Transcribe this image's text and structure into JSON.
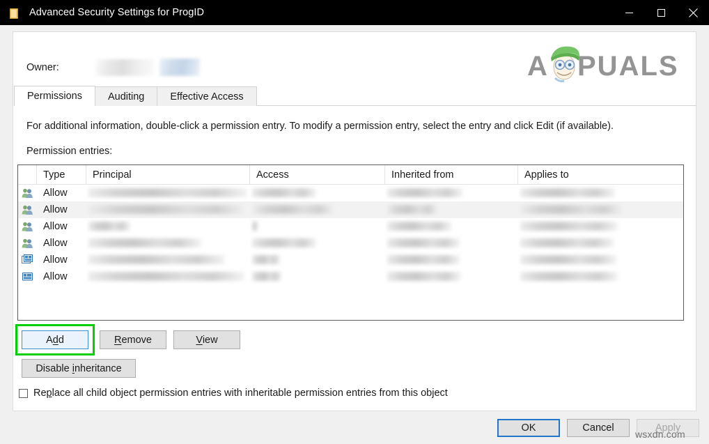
{
  "window": {
    "title": "Advanced Security Settings for ProgID",
    "icon": "folder-icon",
    "caption_buttons": [
      {
        "name": "minimize",
        "glyph": "minimize-icon"
      },
      {
        "name": "maximize",
        "glyph": "maximize-icon"
      },
      {
        "name": "close",
        "glyph": "close-icon"
      }
    ]
  },
  "branding": {
    "logo_text": "APPUALS",
    "logo_color": "#8c8c8c",
    "hat_color": "#6abf5a",
    "watermark": "wsxdn.com",
    "watermark_color": "#767676"
  },
  "owner": {
    "label": "Owner:",
    "value": "",
    "change_link": ""
  },
  "tabs": [
    {
      "label": "Permissions",
      "active": true
    },
    {
      "label": "Auditing",
      "active": false
    },
    {
      "label": "Effective Access",
      "active": false
    }
  ],
  "description": "For additional information, double-click a permission entry. To modify a permission entry, select the entry and click Edit (if available).",
  "entries_label": "Permission entries:",
  "table": {
    "columns": [
      "",
      "Type",
      "Principal",
      "Access",
      "Inherited from",
      "Applies to"
    ],
    "rows": [
      {
        "icon": "users-group-icon",
        "type": "Allow",
        "principal": "",
        "access": "",
        "inherited_from": "",
        "applies_to": "",
        "selected": false
      },
      {
        "icon": "users-group-icon",
        "type": "Allow",
        "principal": "",
        "access": "",
        "inherited_from": "",
        "applies_to": "",
        "selected": true
      },
      {
        "icon": "users-group-icon",
        "type": "Allow",
        "principal": "",
        "access": "",
        "inherited_from": "",
        "applies_to": "",
        "selected": false
      },
      {
        "icon": "users-group-icon",
        "type": "Allow",
        "principal": "",
        "access": "",
        "inherited_from": "",
        "applies_to": "",
        "selected": false
      },
      {
        "icon": "computer-icon",
        "type": "Allow",
        "principal": "",
        "access": "",
        "inherited_from": "",
        "applies_to": "",
        "selected": false
      },
      {
        "icon": "computer-icon",
        "type": "Allow",
        "principal": "",
        "access": "",
        "inherited_from": "",
        "applies_to": "",
        "selected": false
      }
    ]
  },
  "actions": {
    "add": {
      "label_pre": "A",
      "label_accel": "d",
      "label_post": "d",
      "focused": true,
      "highlight_color": "#00d000"
    },
    "remove": {
      "label_accel": "R",
      "label_post": "emove"
    },
    "view": {
      "label_accel": "V",
      "label_post": "iew"
    },
    "disable_inheritance": {
      "label_pre": "Disable ",
      "label_accel": "i",
      "label_post": "nheritance"
    }
  },
  "replace_checkbox": {
    "checked": false,
    "label_pre": "Re",
    "label_accel": "p",
    "label_post": "lace all child object permission entries with inheritable permission entries from this object"
  },
  "footer": {
    "ok": {
      "label": "OK",
      "default": true
    },
    "cancel": {
      "label": "Cancel"
    },
    "apply": {
      "label_accel": "A",
      "label_post": "pply",
      "disabled": true
    }
  }
}
